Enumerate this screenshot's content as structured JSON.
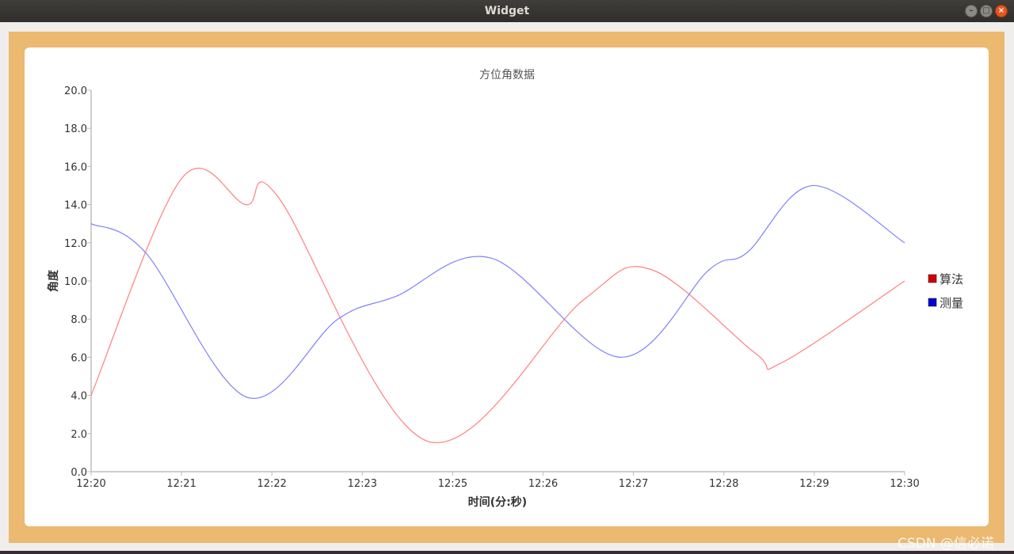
{
  "window": {
    "title": "Widget",
    "controls": {
      "minimize_icon": "minimize-icon",
      "maximize_icon": "maximize-icon",
      "close_icon": "close-icon"
    }
  },
  "colors": {
    "frame": "#ebb96f",
    "series_algo": "#ff8080",
    "series_meas": "#8080ff",
    "legend_algo_swatch": "#d40000",
    "legend_meas_swatch": "#0000d4"
  },
  "watermark": "CSDN @信必诺",
  "chart_data": {
    "type": "line",
    "title": "方位角数据",
    "xlabel": "时间(分:秒)",
    "ylabel": "角度",
    "x_ticks": [
      "12:20",
      "12:21",
      "12:22",
      "12:23",
      "12:25",
      "12:26",
      "12:27",
      "12:28",
      "12:29",
      "12:30"
    ],
    "y_ticks": [
      "0.0",
      "2.0",
      "4.0",
      "6.0",
      "8.0",
      "10.0",
      "12.0",
      "14.0",
      "16.0",
      "18.0",
      "20.0"
    ],
    "ylim": [
      0,
      20
    ],
    "legend_position": "right",
    "grid": false,
    "curve": "smooth",
    "series": [
      {
        "name": "算法",
        "color": "#ff8080",
        "points": [
          [
            "12:20",
            4.0
          ],
          [
            "12:21:07",
            15.4
          ],
          [
            "12:21:54",
            14.0
          ],
          [
            "12:22:18",
            14.4
          ],
          [
            "12:24:08",
            1.6
          ],
          [
            "12:26:03",
            9.0
          ],
          [
            "12:26:53",
            10.6
          ],
          [
            "12:28:10",
            6.2
          ],
          [
            "12:28:29",
            5.7
          ],
          [
            "12:30",
            10.0
          ]
        ]
      },
      {
        "name": "测量",
        "color": "#8080ff",
        "points": [
          [
            "12:20",
            13.0
          ],
          [
            "12:20:40",
            11.5
          ],
          [
            "12:21:55",
            3.9
          ],
          [
            "12:23:02",
            8.0
          ],
          [
            "12:23:45",
            9.2
          ],
          [
            "12:24:55",
            11.2
          ],
          [
            "12:26:30",
            6.0
          ],
          [
            "12:27:36",
            10.6
          ],
          [
            "12:28:04",
            11.5
          ],
          [
            "12:28:52",
            15.0
          ],
          [
            "12:30",
            12.0
          ]
        ]
      }
    ]
  }
}
